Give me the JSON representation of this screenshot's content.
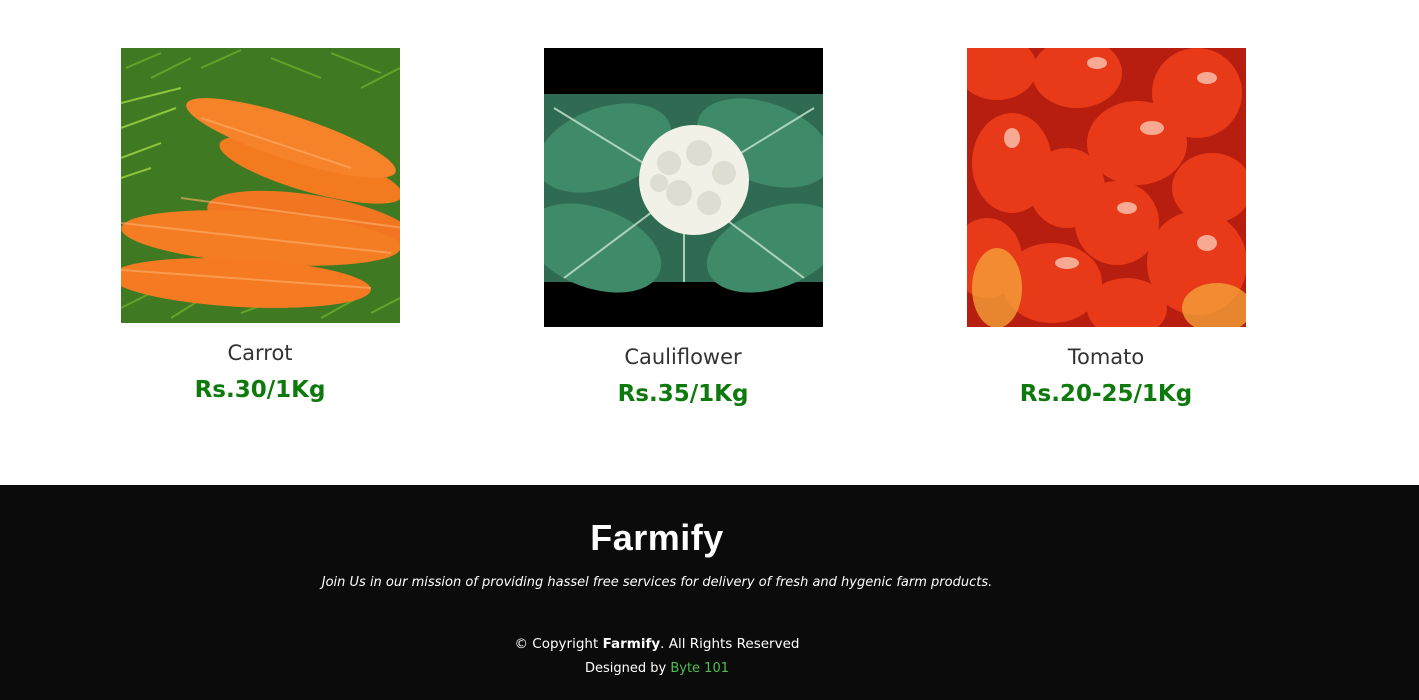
{
  "products": [
    {
      "name": "Carrot",
      "price": "Rs.30/1Kg",
      "image": "carrot-photo"
    },
    {
      "name": "Cauliflower",
      "price": "Rs.35/1Kg",
      "image": "cauliflower-photo"
    },
    {
      "name": "Tomato",
      "price": "Rs.20-25/1Kg",
      "image": "tomato-photo"
    }
  ],
  "footer": {
    "brand": "Farmify",
    "mission": "Join Us in our mission of providing hassel free services for delivery of fresh and hygenic farm products.",
    "copyright_prefix": "© Copyright ",
    "copyright_brand": "Farmify",
    "copyright_suffix": ". All Rights Reserved",
    "designed_prefix": "Designed by ",
    "designer_link": "Byte 101"
  },
  "colors": {
    "price_green": "#0e7a0d",
    "footer_bg": "#0b0b0b",
    "link_green": "#4fbf4f"
  }
}
